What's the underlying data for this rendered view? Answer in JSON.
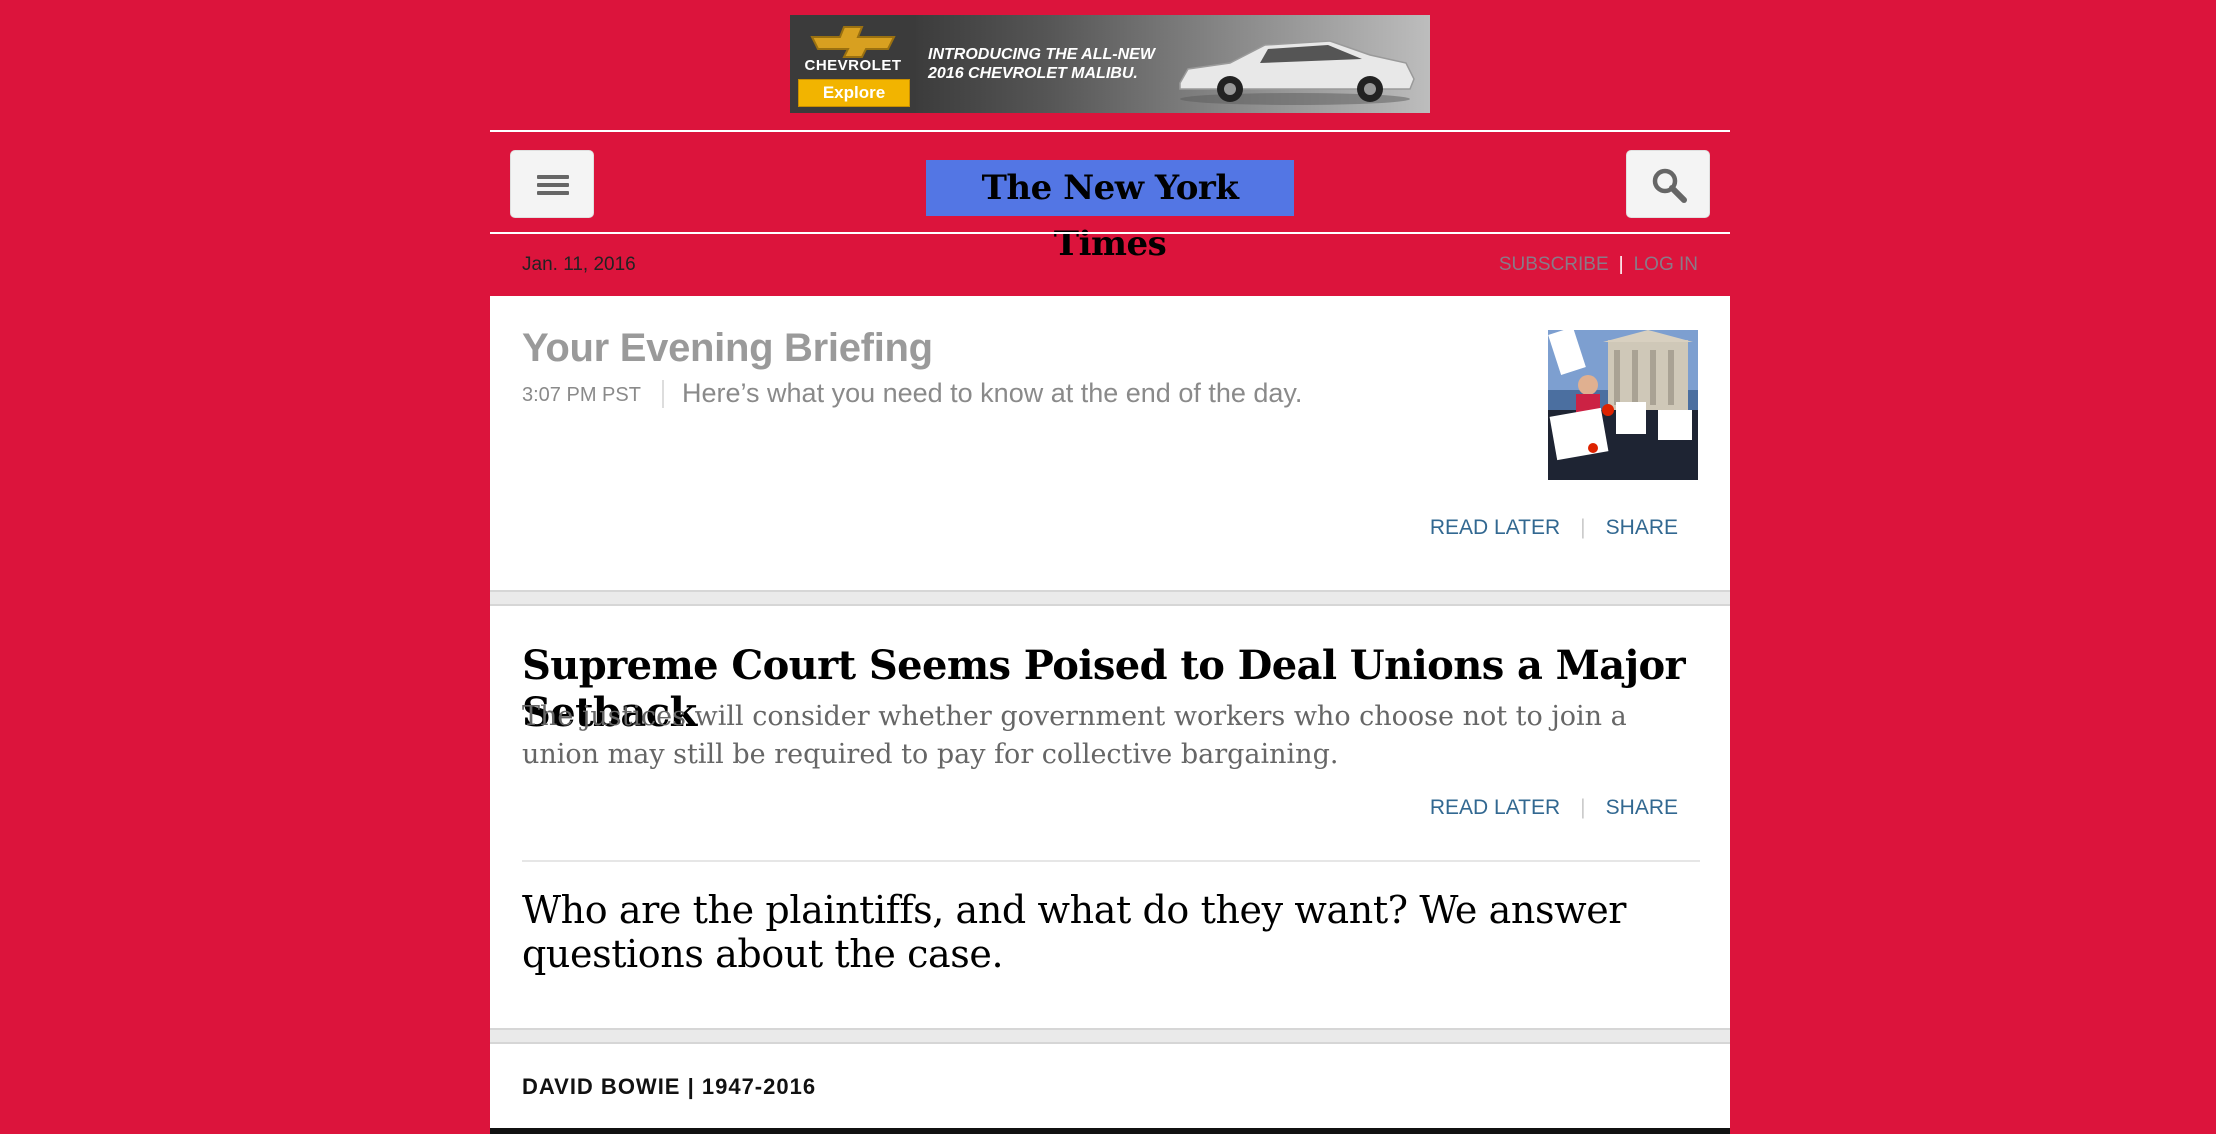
{
  "ad": {
    "brand": "CHEVROLET",
    "cta": "Explore",
    "headline": "INTRODUCING THE ALL-NEW 2016 CHEVROLET MALIBU.",
    "brand_color": "#f2b400"
  },
  "header": {
    "menu_icon": "hamburger-icon",
    "logo": "The New York Times",
    "search_icon": "search-icon",
    "logo_highlight": "#5376e4"
  },
  "datebar": {
    "date": "Jan. 11, 2016",
    "subscribe": "SUBSCRIBE",
    "login": "LOG IN",
    "separator": "|"
  },
  "briefing": {
    "title": "Your Evening Briefing",
    "time": "3:07 PM PST",
    "summary": "Here’s what you need to know at the end of the day.",
    "read_later": "READ LATER",
    "share": "SHARE",
    "separator": "|"
  },
  "story": {
    "headline": "Supreme Court Seems Poised to Deal Unions a Major Setback",
    "summary": "The justices will consider whether government workers who choose not to join a union may still be required to pay for collective bargaining.",
    "read_later": "READ LATER",
    "share": "SHARE",
    "separator": "|",
    "related": "Who are the plaintiffs, and what do they want? We answer questions about the case."
  },
  "section": {
    "kicker": "DAVID BOWIE | 1947-2016"
  },
  "colors": {
    "background": "#dc143c",
    "link": "#326891",
    "card": "#ffffff"
  }
}
